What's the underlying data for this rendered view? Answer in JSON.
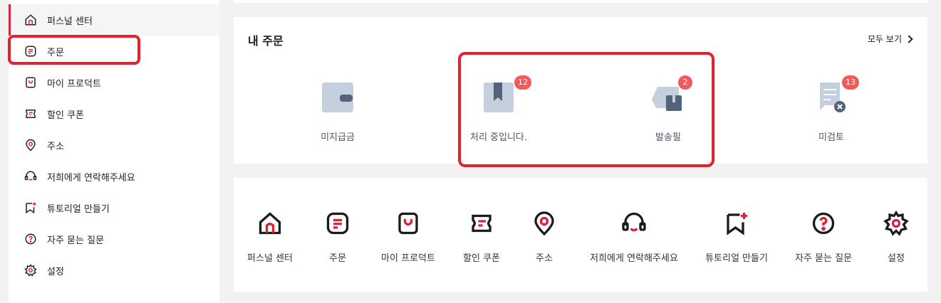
{
  "sidebar": {
    "items": [
      {
        "label": "퍼스널 센터",
        "icon": "home-icon"
      },
      {
        "label": "주문",
        "icon": "order-icon"
      },
      {
        "label": "마이 프로덕트",
        "icon": "product-bag-icon"
      },
      {
        "label": "할인 쿠폰",
        "icon": "coupon-icon"
      },
      {
        "label": "주소",
        "icon": "location-pin-icon"
      },
      {
        "label": "저희에게 연락해주세요",
        "icon": "headset-icon"
      },
      {
        "label": "튜토리얼 만들기",
        "icon": "bookmark-plus-icon"
      },
      {
        "label": "자주 묻는 질문",
        "icon": "question-icon"
      },
      {
        "label": "설정",
        "icon": "gear-icon"
      }
    ]
  },
  "orders": {
    "title": "내 주문",
    "view_all": "모두 보기",
    "statuses": [
      {
        "label": "미지급금",
        "badge": null,
        "icon": "wallet-icon"
      },
      {
        "label": "처리 중입니다.",
        "badge": "12",
        "icon": "box-icon"
      },
      {
        "label": "발송필",
        "badge": "2",
        "icon": "truck-icon"
      },
      {
        "label": "미검토",
        "badge": "13",
        "icon": "review-icon"
      }
    ]
  },
  "quick_links": [
    {
      "label": "퍼스널 센터",
      "icon": "home-icon"
    },
    {
      "label": "주문",
      "icon": "order-icon"
    },
    {
      "label": "마이 프로덕트",
      "icon": "product-bag-icon"
    },
    {
      "label": "할인 쿠폰",
      "icon": "coupon-icon"
    },
    {
      "label": "주소",
      "icon": "location-pin-icon"
    },
    {
      "label": "저희에게 연락해주세요",
      "icon": "headset-icon"
    },
    {
      "label": "튜토리얼 만들기",
      "icon": "bookmark-plus-icon"
    },
    {
      "label": "자주 묻는 질문",
      "icon": "question-icon"
    },
    {
      "label": "설정",
      "icon": "gear-icon"
    }
  ],
  "colors": {
    "accent": "#d8233c",
    "badge": "#f05a5a",
    "highlight": "#e4212c",
    "status_icon": "#c5d0df"
  }
}
